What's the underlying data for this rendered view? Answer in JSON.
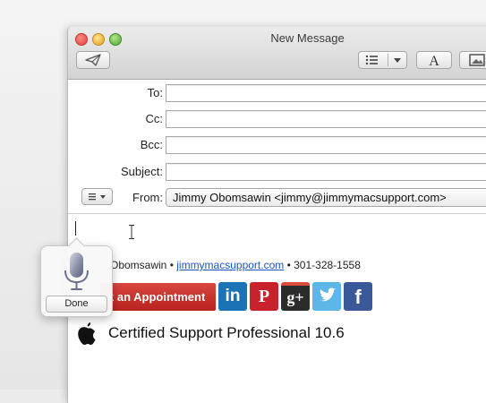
{
  "window": {
    "title": "New Message"
  },
  "toolbar": {
    "send_icon": "paper-plane-icon",
    "list_icon": "list-icon",
    "font_icon": "font-icon",
    "photo_icon": "photo-browser-icon"
  },
  "header": {
    "to_label": "To:",
    "cc_label": "Cc:",
    "bcc_label": "Bcc:",
    "subject_label": "Subject:",
    "from_label": "From:",
    "from_value": "Jimmy Obomsawin <jimmy@jimmymacsupport.com>",
    "to_value": "",
    "cc_value": "",
    "bcc_value": "",
    "subject_value": ""
  },
  "signature": {
    "name_partial": "Obomsawin • ",
    "link": "jimmymacsupport.com",
    "phone": " • 301-328-1558",
    "appointment_button": "k an Appointment",
    "social": [
      "linkedin",
      "pinterest",
      "google-plus",
      "twitter",
      "facebook"
    ],
    "linkedin_text": "in",
    "pinterest_text": "P",
    "googleplus_text": "g+",
    "facebook_text": "f",
    "cert_text": "Certified Support Professional 10.6"
  },
  "dictation": {
    "done_label": "Done",
    "icon": "microphone-icon"
  },
  "colors": {
    "accent": "#c2302a",
    "link": "#1a55c9",
    "linkedin": "#1a73b5",
    "pinterest": "#c8232c",
    "twitter": "#5cb6e6",
    "facebook": "#3b5998"
  }
}
